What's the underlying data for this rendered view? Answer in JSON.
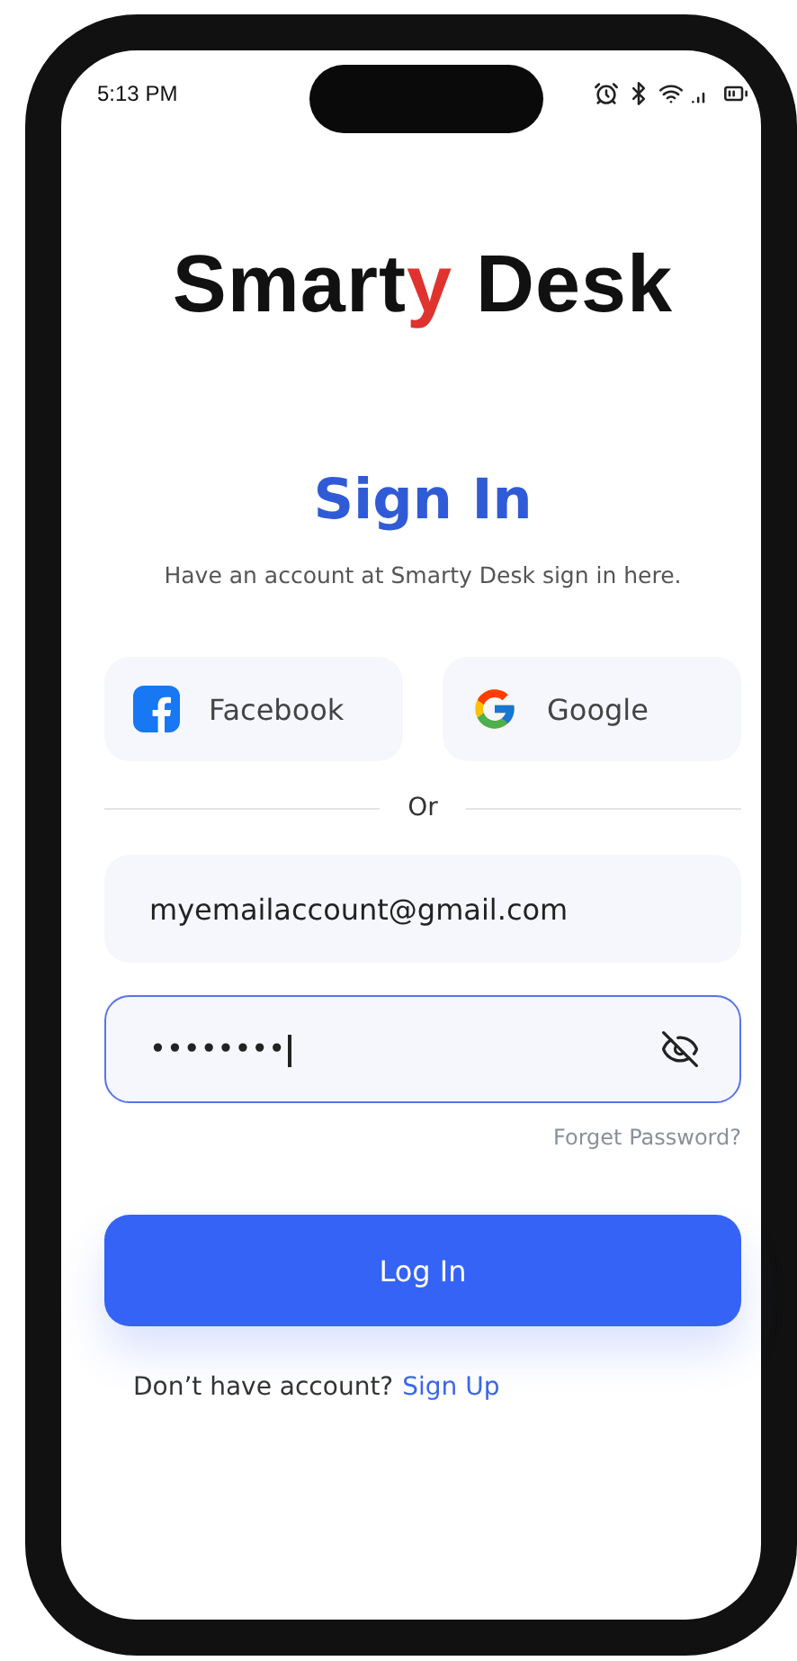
{
  "status_bar": {
    "time": "5:13 PM"
  },
  "logo": {
    "before": "Smart",
    "accent": "y",
    "after": " Desk"
  },
  "title": "Sign In",
  "subtitle": "Have an account at Smarty Desk sign in here.",
  "social_buttons": [
    {
      "kind": "facebook",
      "label": "Facebook"
    },
    {
      "kind": "google",
      "label": "Google"
    }
  ],
  "divider_label": "Or",
  "email_field": {
    "value": "myemailaccount@gmail.com",
    "focused": false
  },
  "password_field": {
    "value": "••••••••",
    "focused": true
  },
  "forgot_link": "Forget Password?",
  "login_button": "Log In",
  "signup_prompt": {
    "text": "Don’t have account?",
    "link": "Sign Up"
  }
}
